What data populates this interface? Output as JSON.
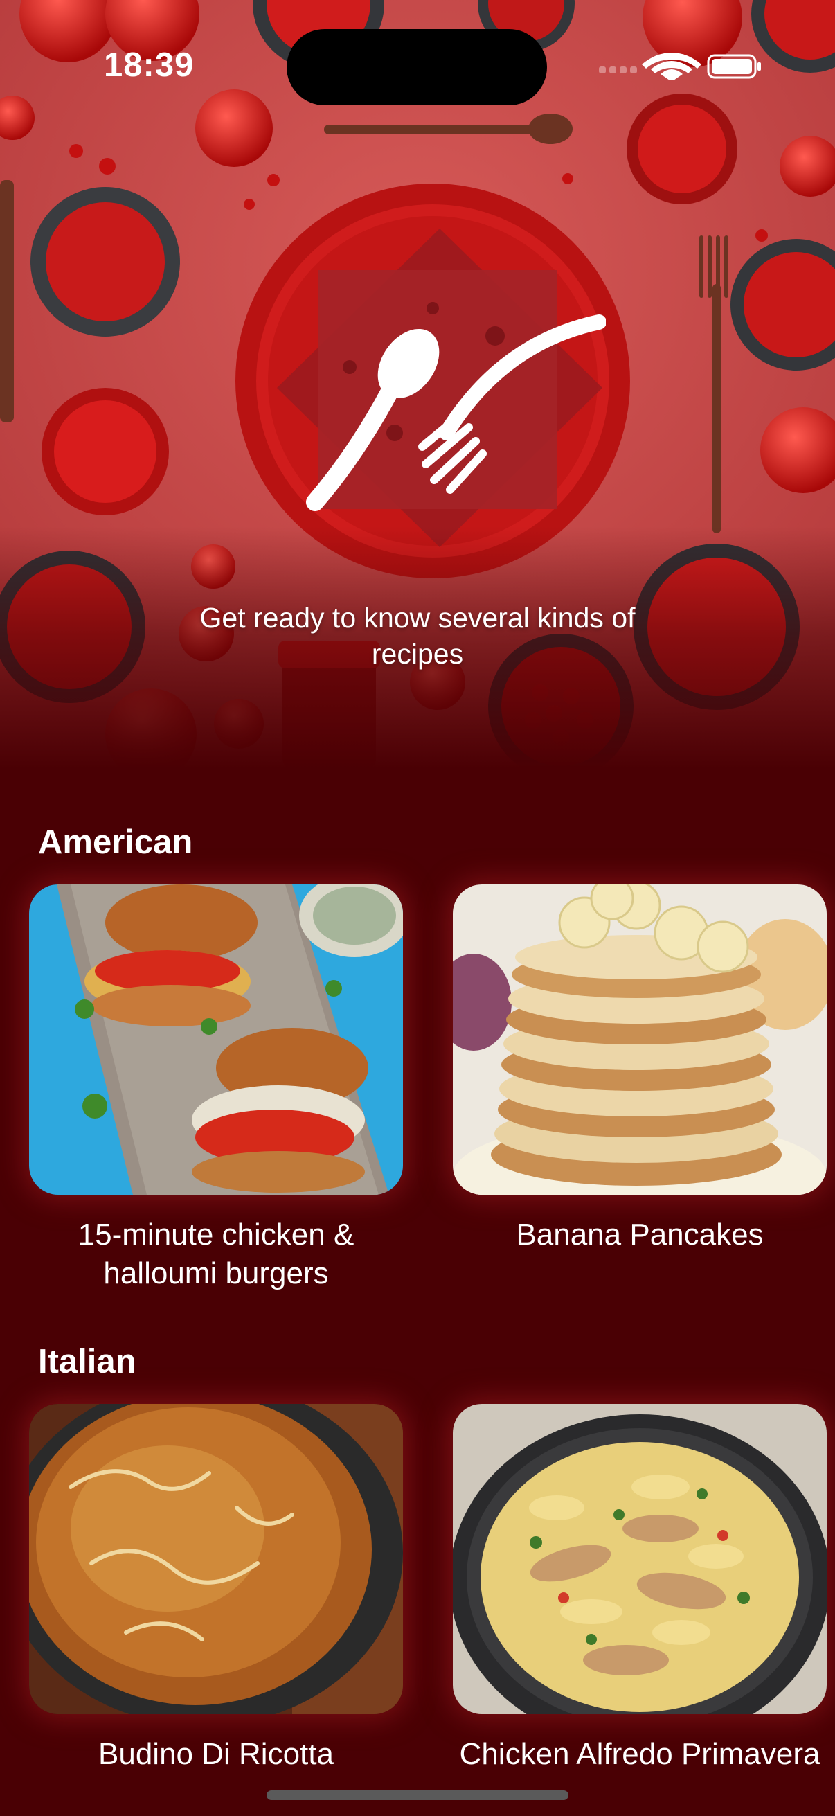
{
  "status_bar": {
    "time": "18:39"
  },
  "hero": {
    "tagline": "Get ready to know several kinds of recipes",
    "logo_icon": "spoon-fork-icon"
  },
  "sections": [
    {
      "title": "American",
      "recipes": [
        {
          "name": "15-minute chicken & halloumi burgers",
          "image": "chicken-burgers-photo"
        },
        {
          "name": "Banana Pancakes",
          "image": "banana-pancakes-photo"
        }
      ]
    },
    {
      "title": "Italian",
      "recipes": [
        {
          "name": "Budino Di Ricotta",
          "image": "ricotta-cake-photo"
        },
        {
          "name": "Chicken Alfredo Primavera",
          "image": "chicken-alfredo-photo"
        }
      ]
    }
  ],
  "colors": {
    "background": "#4a0004",
    "hero": "#c94a4a",
    "accent": "#d01e1e",
    "text": "#ffffff"
  }
}
